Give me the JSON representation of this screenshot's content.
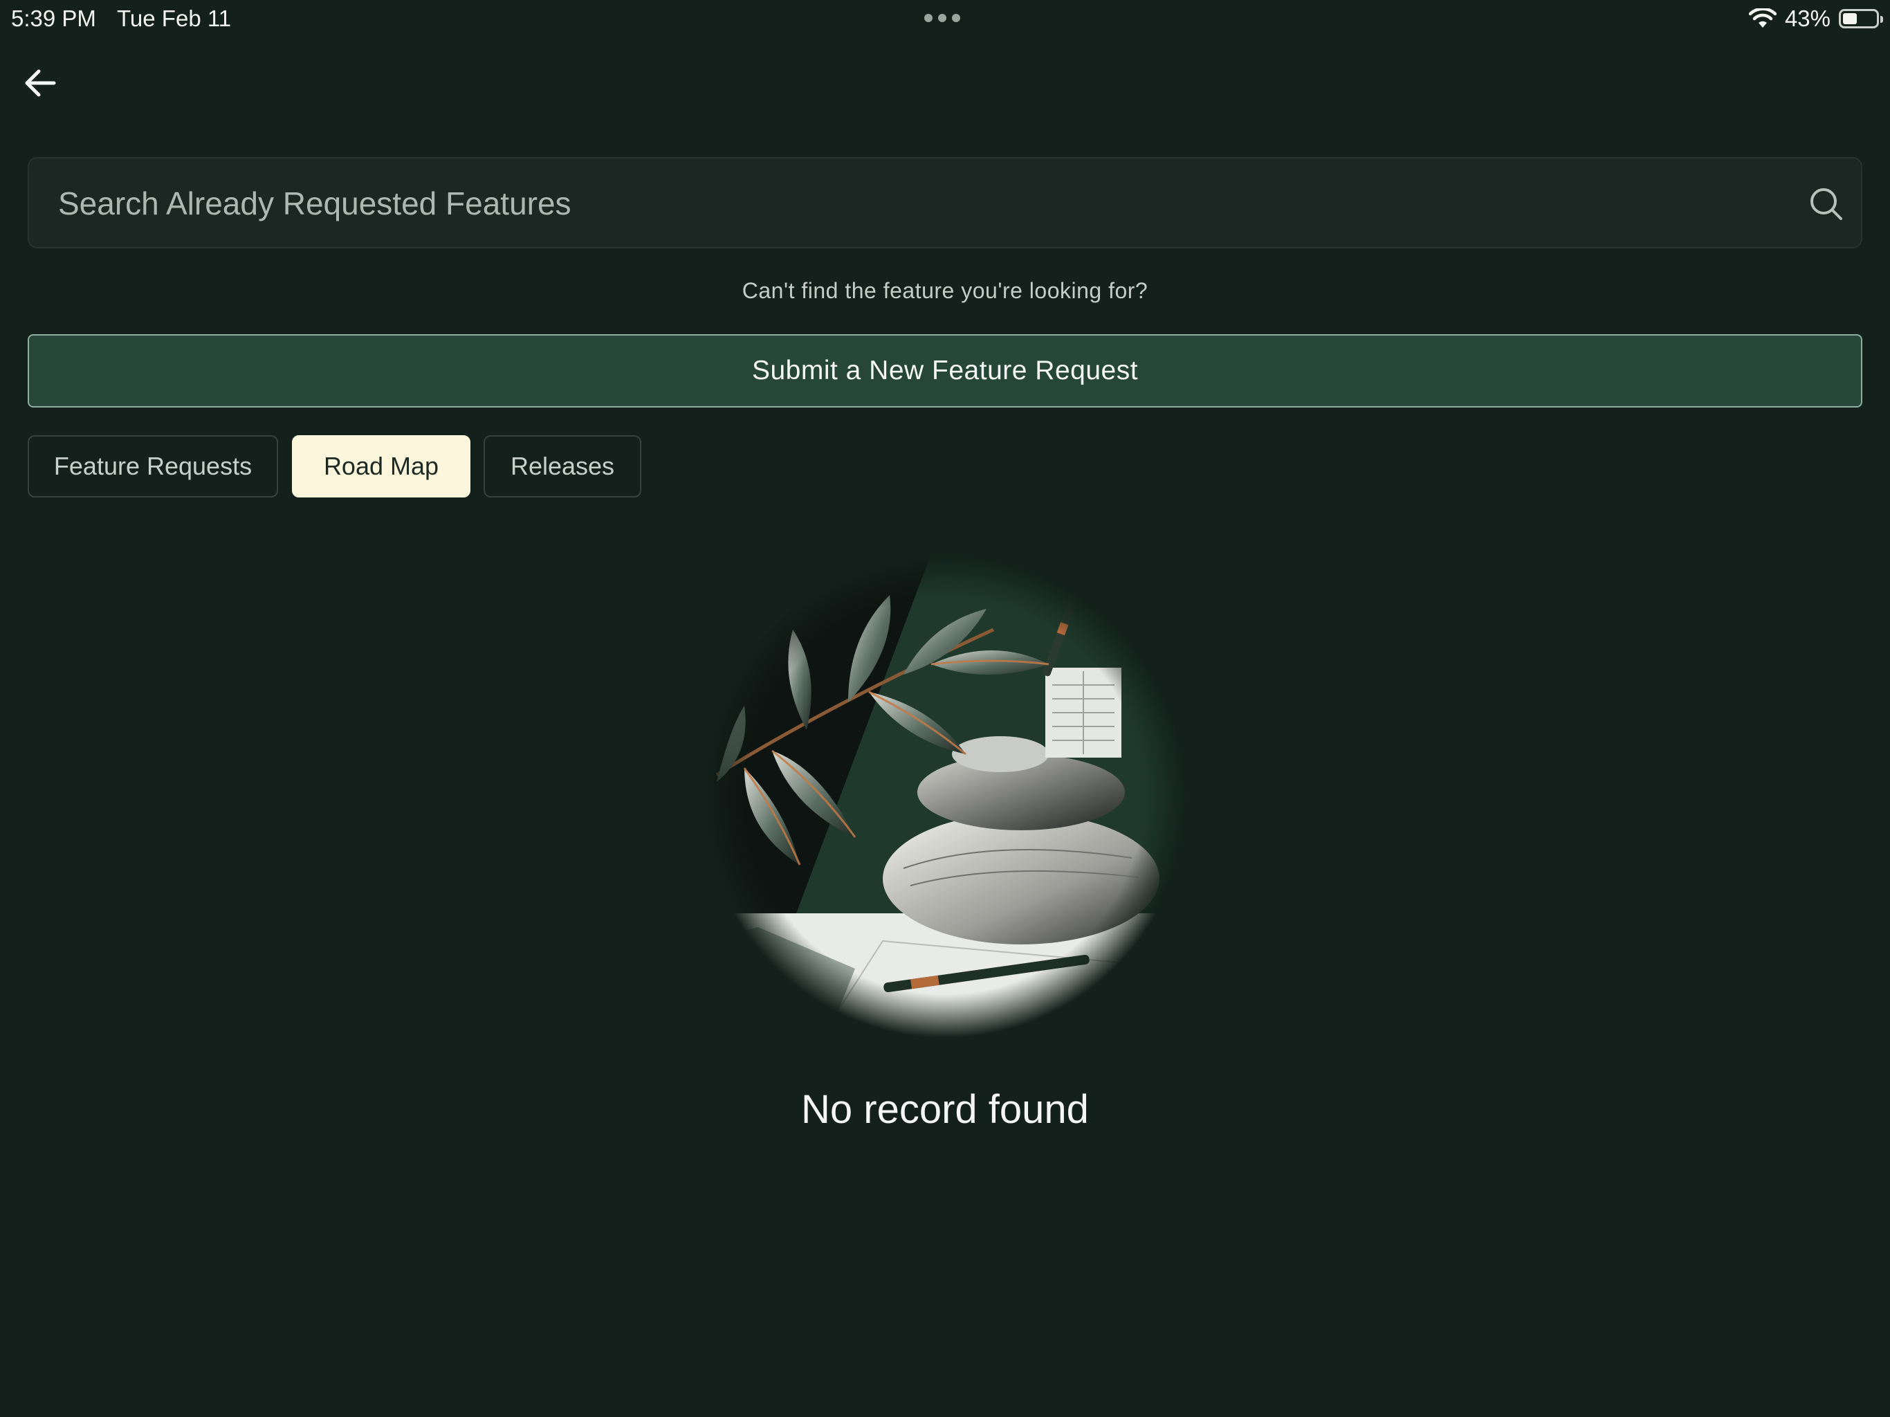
{
  "status_bar": {
    "time": "5:39 PM",
    "date": "Tue Feb 11",
    "battery_percent": "43%",
    "battery_level": 0.43,
    "icons": [
      "wifi-icon",
      "battery-icon",
      "multitask-dots-icon"
    ]
  },
  "nav": {
    "back_icon": "arrow-left-icon"
  },
  "search": {
    "placeholder": "Search Already Requested Features",
    "value": "",
    "icon": "search-icon"
  },
  "hint_text": "Can't find the feature you're looking for?",
  "submit_label": "Submit a New Feature Request",
  "tabs": [
    {
      "label": "Feature Requests",
      "active": false
    },
    {
      "label": "Road Map",
      "active": true
    },
    {
      "label": "Releases",
      "active": false
    }
  ],
  "empty_state": {
    "message": "No record found",
    "illustration": "zen-stones-leaves-illustration"
  },
  "colors": {
    "background": "#13201b",
    "accent_button": "#26463a",
    "active_tab": "#fcf7dc"
  }
}
